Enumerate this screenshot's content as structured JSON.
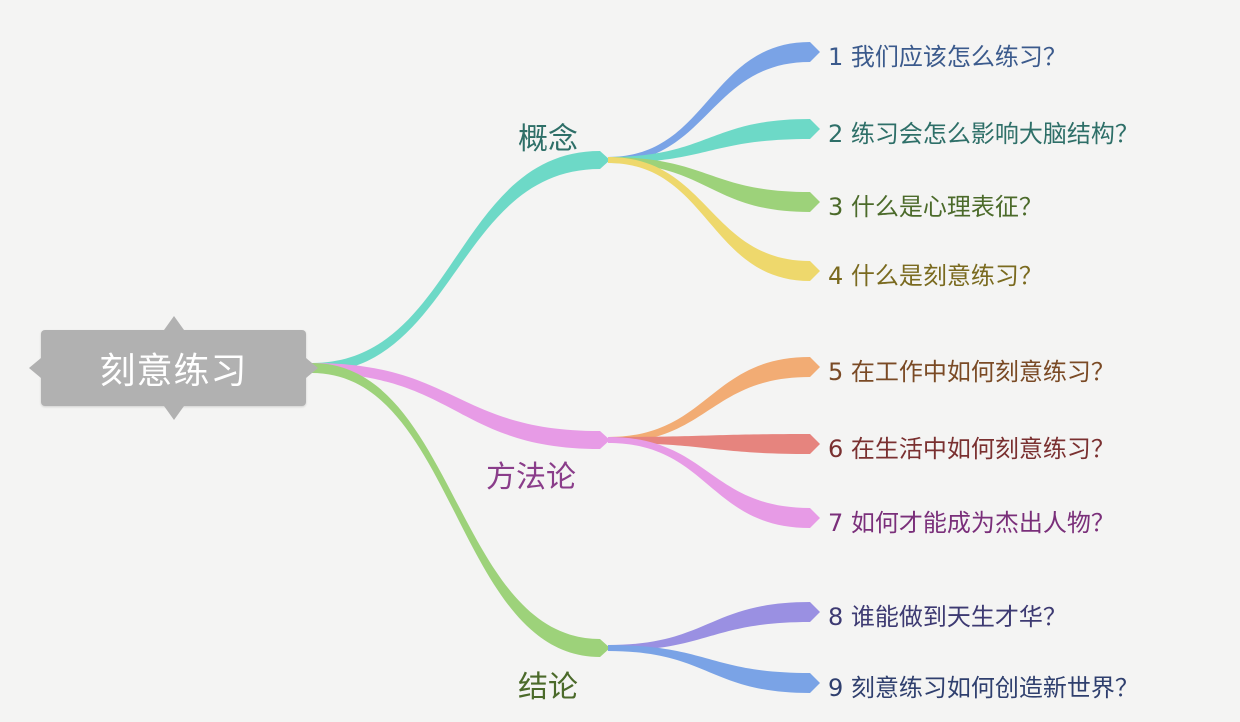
{
  "root": {
    "label": "刻意练习"
  },
  "branches": [
    {
      "label": "概念",
      "color": "#2e6f68",
      "leaves": [
        {
          "label": "1 我们应该怎么练习？",
          "color": "#3b5a8c",
          "stroke": "#7aa3e6"
        },
        {
          "label": "2 练习会怎么影响大脑结构？",
          "color": "#2e6f68",
          "stroke": "#6dd9c7"
        },
        {
          "label": "3 什么是心理表征？",
          "color": "#4b6a2a",
          "stroke": "#9dd27a"
        },
        {
          "label": "4 什么是刻意练习？",
          "color": "#7a6a1f",
          "stroke": "#eed86c"
        }
      ]
    },
    {
      "label": "方法论",
      "color": "#8a3d8a",
      "leaves": [
        {
          "label": "5 在工作中如何刻意练习？",
          "color": "#7a4a25",
          "stroke": "#f2ac74"
        },
        {
          "label": "6 在生活中如何刻意练习？",
          "color": "#7a3030",
          "stroke": "#e6847e"
        },
        {
          "label": "7 如何才能成为杰出人物？",
          "color": "#7a2f7a",
          "stroke": "#e79be6"
        }
      ]
    },
    {
      "label": "结论",
      "color": "#4b6a2a",
      "leaves": [
        {
          "label": "8 谁能做到天生才华？",
          "color": "#3d3a72",
          "stroke": "#9a90e2"
        },
        {
          "label": "9 刻意练习如何创造新世界？",
          "color": "#2f3f6e",
          "stroke": "#7aa3e6"
        }
      ]
    }
  ],
  "branch_strokes": [
    "#6dd9c7",
    "#e79be6",
    "#9dd27a"
  ]
}
